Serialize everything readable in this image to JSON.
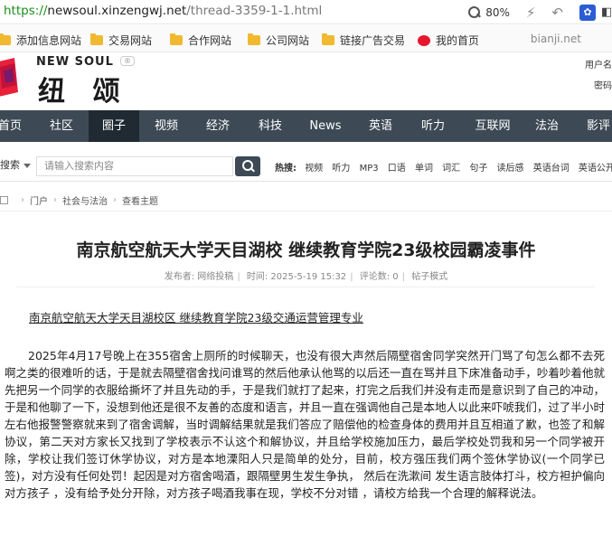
{
  "browser": {
    "url_proto": "https://",
    "url_host": "newsoul.xinzengwj.net",
    "url_path": "/thread-3359-1-1.html",
    "zoom": "80%"
  },
  "bookmarks": [
    {
      "label": "添加信息网站",
      "icon": "folder-icon"
    },
    {
      "label": "交易网站",
      "icon": "folder-icon"
    },
    {
      "label": "合作网站",
      "icon": "folder-icon"
    },
    {
      "label": "公司网站",
      "icon": "folder-icon"
    },
    {
      "label": "链接广告交易",
      "icon": "folder-icon"
    },
    {
      "label": "我的首页",
      "icon": "weibo-icon"
    }
  ],
  "bookmarks_right": "bianji.net",
  "site": {
    "logo_en": "NEW SOUL",
    "logo_cn": "纽 颂",
    "login_user": "用户名",
    "login_pass": "密码"
  },
  "nav": [
    "首页",
    "社区",
    "圈子",
    "视频",
    "经济",
    "科技",
    "News",
    "英语",
    "听力",
    "互联网",
    "法治",
    "影评"
  ],
  "nav_active": "圈子",
  "search": {
    "type": "搜索",
    "placeholder": "请输入搜索内容",
    "hot_label": "热搜:",
    "hot": [
      "视频",
      "听力",
      "MP3",
      "口语",
      "单词",
      "词汇",
      "句子",
      "读后感",
      "英语台词",
      "英语公开课",
      "大"
    ]
  },
  "breadcrumb": [
    "门户",
    "社会与法治",
    "查看主题"
  ],
  "article": {
    "title": "南京航空航天大学天目湖校 继续教育学院23级校园霸凌事件",
    "meta_author": "发布者: 网络投稿",
    "meta_time": "时间: 2025-5-19 15:32",
    "meta_comments": "评论数: 0",
    "meta_style": "帖子模式",
    "lead": "南京航空航天大学天目湖校区 继续教育学院23级交通运营管理专业",
    "body": "2025年4月17号晚上在355宿舍上厕所的时候聊天，也没有很大声然后隔壁宿舍同学突然开门骂了句怎么都不去死啊之类的很难听的话，于是就去隔壁宿舍找问谁骂的然后他承认他骂的以后还一直在骂并且下床准备动手，吵着吵着他就先把另一个同学的衣服给撕坏了并且先动的手，于是我们就打了起来，打完之后我们并没有走而是意识到了自己的冲动，于是和他聊了一下，没想到他还是很不友善的态度和语言，并且一直在强调他自己是本地人以此来吓唬我们，过了半小时左右他报警警察就来到了宿舍调解，当时调解结果就是我们答应了赔偿他的检查身体的费用并且互相道了歉，也签了和解协议，第二天对方家长又找到了学校表示不认这个和解协议，并且给学校施加压力，最后学校处罚我和另一个同学被开除，学校让我们签订休学协议，对方是本地溧阳人只是简单的处分，目前，校方强压我们两个签休学协议(一个同学已签)，对方没有任何处罚！起因是对方宿舍喝酒，跟隔壁男生发生争执， 然后在洗漱间 发生语言肢体打斗，校方袒护偏向对方孩子 ，没有给予处分开除，对方孩子喝酒我事在现，学校不分对错 ，请校方给我一个合理的解释说法。"
  },
  "colors": {
    "nav_bg": "#3d4a55",
    "nav_active_bg": "#202a32",
    "url_proto": "#1b8e1b"
  }
}
